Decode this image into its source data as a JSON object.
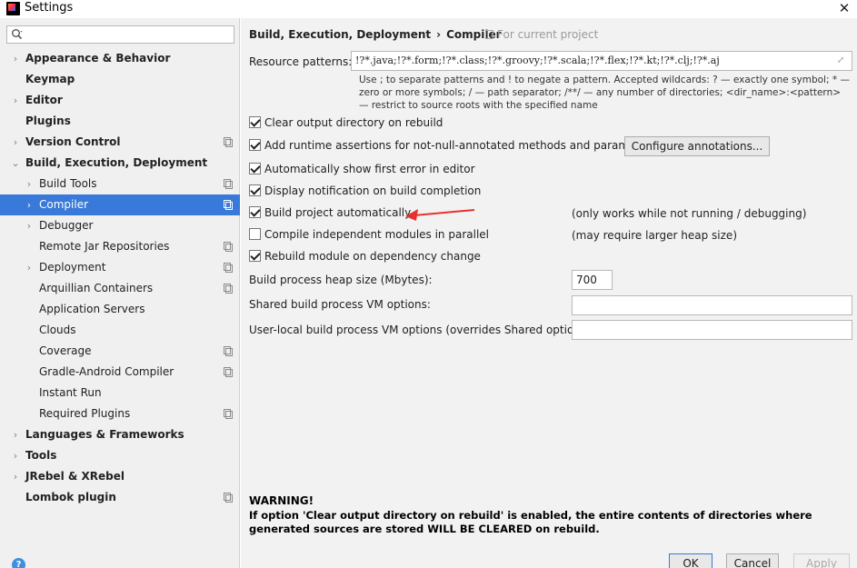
{
  "window": {
    "title": "Settings",
    "close_icon": "close-icon"
  },
  "search": {
    "placeholder": "",
    "icon": "search-icon"
  },
  "sidebar": {
    "items": [
      {
        "label": "Appearance & Behavior",
        "bold": true,
        "arrow": "›",
        "level": 0
      },
      {
        "label": "Keymap",
        "bold": true,
        "arrow": "",
        "level": 0
      },
      {
        "label": "Editor",
        "bold": true,
        "arrow": "›",
        "level": 0
      },
      {
        "label": "Plugins",
        "bold": true,
        "arrow": "",
        "level": 0
      },
      {
        "label": "Version Control",
        "bold": true,
        "arrow": "›",
        "level": 0,
        "project": true
      },
      {
        "label": "Build, Execution, Deployment",
        "bold": true,
        "arrow": "⌄",
        "level": 0
      },
      {
        "label": "Build Tools",
        "bold": false,
        "arrow": "›",
        "level": 1,
        "project": true
      },
      {
        "label": "Compiler",
        "bold": false,
        "arrow": "›",
        "level": 1,
        "project": true,
        "selected": true
      },
      {
        "label": "Debugger",
        "bold": false,
        "arrow": "›",
        "level": 1
      },
      {
        "label": "Remote Jar Repositories",
        "bold": false,
        "arrow": "",
        "level": 1,
        "project": true
      },
      {
        "label": "Deployment",
        "bold": false,
        "arrow": "›",
        "level": 1,
        "project": true
      },
      {
        "label": "Arquillian Containers",
        "bold": false,
        "arrow": "",
        "level": 1,
        "project": true
      },
      {
        "label": "Application Servers",
        "bold": false,
        "arrow": "",
        "level": 1
      },
      {
        "label": "Clouds",
        "bold": false,
        "arrow": "",
        "level": 1
      },
      {
        "label": "Coverage",
        "bold": false,
        "arrow": "",
        "level": 1,
        "project": true
      },
      {
        "label": "Gradle-Android Compiler",
        "bold": false,
        "arrow": "",
        "level": 1,
        "project": true
      },
      {
        "label": "Instant Run",
        "bold": false,
        "arrow": "",
        "level": 1
      },
      {
        "label": "Required Plugins",
        "bold": false,
        "arrow": "",
        "level": 1,
        "project": true
      },
      {
        "label": "Languages & Frameworks",
        "bold": true,
        "arrow": "›",
        "level": 0
      },
      {
        "label": "Tools",
        "bold": true,
        "arrow": "›",
        "level": 0
      },
      {
        "label": "JRebel & XRebel",
        "bold": true,
        "arrow": "›",
        "level": 0
      },
      {
        "label": "Lombok plugin",
        "bold": true,
        "arrow": "",
        "level": 0,
        "project": true
      }
    ],
    "help": "?"
  },
  "main": {
    "breadcrumb": {
      "parent": "Build, Execution, Deployment",
      "separator": "›",
      "current": "Compiler"
    },
    "for_project": "For current project",
    "resource_patterns": {
      "label": "Resource patterns:",
      "value": "!?*.java;!?*.form;!?*.class;!?*.groovy;!?*.scala;!?*.flex;!?*.kt;!?*.clj;!?*.aj",
      "hint": "Use ; to separate patterns and ! to negate a pattern. Accepted wildcards: ? — exactly one symbol; * — zero or more symbols; / — path separator; /**/ — any number of directories; <dir_name>:<pattern> — restrict to source roots with the specified name"
    },
    "options": [
      {
        "label": "Clear output directory on rebuild",
        "checked": true
      },
      {
        "label": "Add runtime assertions for not-null-annotated methods and parameters",
        "checked": true
      },
      {
        "label": "Automatically show first error in editor",
        "checked": true
      },
      {
        "label": "Display notification on build completion",
        "checked": true
      },
      {
        "label": "Build project automatically",
        "checked": true,
        "note": "(only works while not running / debugging)"
      },
      {
        "label": "Compile independent modules in parallel",
        "checked": false,
        "note": "(may require larger heap size)"
      },
      {
        "label": "Rebuild module on dependency change",
        "checked": true
      }
    ],
    "configure_annotations": "Configure annotations...",
    "heap": {
      "label": "Build process heap size (Mbytes):",
      "value": "700"
    },
    "shared_vm": {
      "label": "Shared build process VM options:",
      "value": ""
    },
    "user_vm": {
      "label": "User-local build process VM options (overrides Shared options):",
      "value": ""
    },
    "warning": {
      "title": "WARNING!",
      "text": "If option 'Clear output directory on rebuild' is enabled, the entire contents of directories where generated sources are stored WILL BE CLEARED on rebuild."
    },
    "buttons": {
      "ok": "OK",
      "cancel": "Cancel",
      "apply": "Apply"
    },
    "annotation_arrow_color": "#e8312f"
  }
}
